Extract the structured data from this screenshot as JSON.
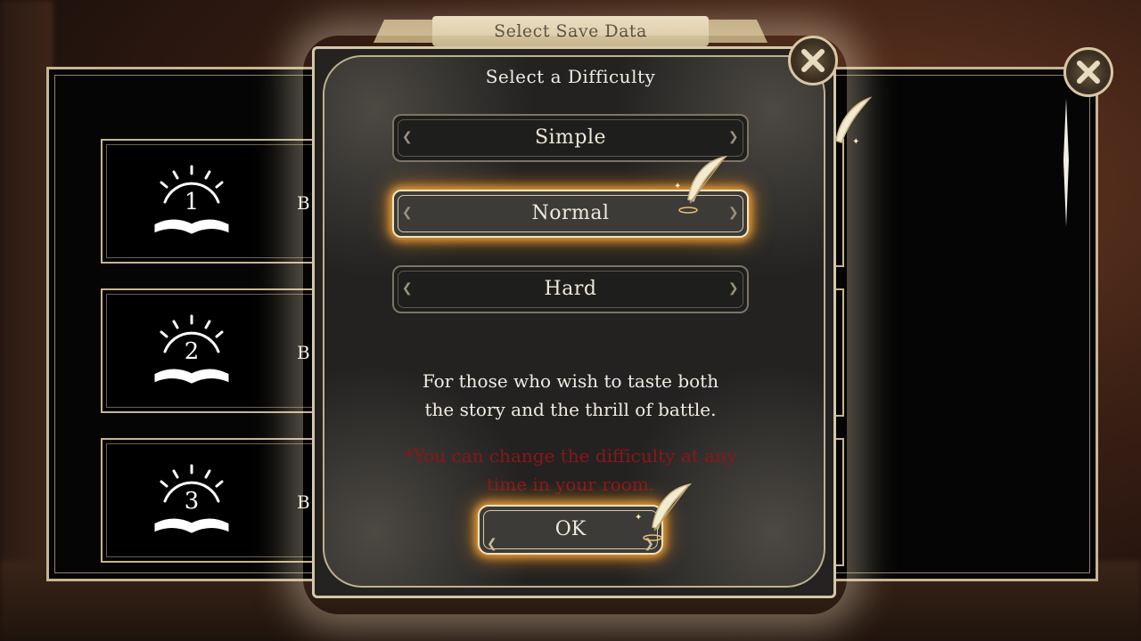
{
  "back_panel": {
    "title": "Select Save Data",
    "slots": [
      {
        "number": "1",
        "label_fragment": "B"
      },
      {
        "number": "2",
        "label_fragment": "B"
      },
      {
        "number": "3",
        "label_fragment": "B"
      }
    ]
  },
  "dialog": {
    "title": "Select a Difficulty",
    "options": [
      {
        "label": "Simple",
        "selected": false
      },
      {
        "label": "Normal",
        "selected": true
      },
      {
        "label": "Hard",
        "selected": false
      }
    ],
    "description_line1": "For those who wish to taste both",
    "description_line2": "the story and the thrill of battle.",
    "note_line1": "*You can change the difficulty at any",
    "note_line2": "time in your room.",
    "ok_label": "OK"
  },
  "colors": {
    "accent_glow": "#f0a030",
    "frame_gold": "#d6c8a8",
    "note_red": "#8a1717",
    "dialog_bg": "#242322"
  },
  "icons": [
    "close-icon",
    "quill-cursor-icon",
    "save-book-icon"
  ]
}
